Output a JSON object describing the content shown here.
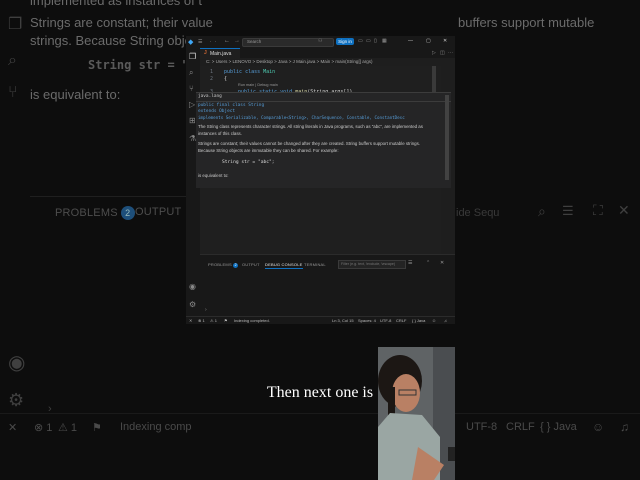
{
  "background": {
    "line1": "implemented as instances of t",
    "line2": "Strings are constant; their value",
    "line2_right": "buffers support mutable",
    "line3": "strings. Because String objects",
    "code": "String str = \"a",
    "equivalent": "is equivalent to:",
    "panel_tabs": {
      "problems": "PROBLEMS",
      "problems_count": "2",
      "output": "OUTPUT"
    },
    "panel_right": "ide Sequ",
    "status": {
      "errors": "1",
      "warnings": "1",
      "indexing": "Indexing comp",
      "encoding": "UTF-8",
      "eol": "CRLF",
      "language": "{ } Java"
    }
  },
  "window": {
    "search": "Search",
    "signin": "Sign in",
    "tab": "Main.java",
    "breadcrumb": "C: > Users > LENOVO > Desktop > Java > J Main.java > Main > main(String[] args)",
    "code": {
      "line1_kw": "public class",
      "line1_name": "Main",
      "line2": "{",
      "codelens": "Run main | Debug main",
      "line3_kw": "public static void",
      "line3_fn": "main",
      "line3_args": "(String args[])"
    },
    "line_numbers": [
      "1",
      "2",
      "3"
    ],
    "hover": {
      "pkg": "java.lang",
      "decl1": "public final class String",
      "decl2": "extends Object",
      "decl3": "implements Serializable, Comparable<String>, CharSequence, Constable, ConstantDesc",
      "p1": "The String class represents character strings. All string literals in Java programs, such as \"abc\", are implemented as instances of this class.",
      "p2": "Strings are constant; their values cannot be changed after they are created. String buffers support mutable strings. Because String objects are immutable they can be shared. For example:",
      "example": "String str = \"abc\";",
      "p3": "is equivalent to:"
    },
    "panel": {
      "problems": "PROBLEMS",
      "problems_count": "2",
      "output": "OUTPUT",
      "debug": "DEBUG CONSOLE",
      "terminal": "TERMINAL",
      "filter": "Filter (e.g. text, !exclude, \\escape)"
    },
    "status": {
      "errors": "1",
      "warnings": "1",
      "indexing": "Indexing completed.",
      "position": "Ln 3, Col 15",
      "spaces": "Spaces: 4",
      "encoding": "UTF-8",
      "eol": "CRLF",
      "language": "{ } Java"
    }
  },
  "caption": "Then next one is"
}
